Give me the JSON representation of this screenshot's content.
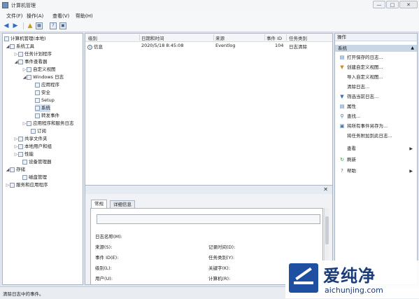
{
  "window": {
    "title": "计算机管理",
    "min": "—",
    "max": "□",
    "close": "✕"
  },
  "menu": [
    "文件(F)",
    "操作(A)",
    "查看(V)",
    "帮助(H)"
  ],
  "toolbar": {
    "back": "◀",
    "forward": "▶",
    "up": "▲",
    "b1": "▦",
    "b2": "?",
    "b3": "▣"
  },
  "tree": [
    {
      "label": "计算机管理(本地)",
      "indent": 0,
      "arrow": ""
    },
    {
      "label": "系统工具",
      "indent": 1,
      "arrow": "◢"
    },
    {
      "label": "任务计划程序",
      "indent": 2,
      "arrow": "▷"
    },
    {
      "label": "事件查看器",
      "indent": 2,
      "arrow": "◢"
    },
    {
      "label": "自定义视图",
      "indent": 3,
      "arrow": "▷"
    },
    {
      "label": "Windows 日志",
      "indent": 3,
      "arrow": "◢"
    },
    {
      "label": "应用程序",
      "indent": 4,
      "arrow": ""
    },
    {
      "label": "安全",
      "indent": 4,
      "arrow": ""
    },
    {
      "label": "Setup",
      "indent": 4,
      "arrow": ""
    },
    {
      "label": "系统",
      "indent": 4,
      "arrow": ""
    },
    {
      "label": "转发事件",
      "indent": 4,
      "arrow": ""
    },
    {
      "label": "应用程序和服务日志",
      "indent": 3,
      "arrow": "▷"
    },
    {
      "label": "订阅",
      "indent": 3,
      "arrow": ""
    },
    {
      "label": "共享文件夹",
      "indent": 2,
      "arrow": "▷"
    },
    {
      "label": "本地用户和组",
      "indent": 2,
      "arrow": "▷"
    },
    {
      "label": "性能",
      "indent": 2,
      "arrow": "▷"
    },
    {
      "label": "设备管理器",
      "indent": 2,
      "arrow": ""
    },
    {
      "label": "存储",
      "indent": 1,
      "arrow": "◢"
    },
    {
      "label": "磁盘管理",
      "indent": 2,
      "arrow": ""
    },
    {
      "label": "服务和应用程序",
      "indent": 1,
      "arrow": "▷"
    }
  ],
  "grid": {
    "headers": [
      "级别",
      "日期和时间",
      "来源",
      "事件 ID",
      "任务类别"
    ],
    "rows": [
      {
        "level": "信息",
        "datetime": "2020/5/18 8:45:08",
        "source": "Eventlog",
        "id": "104",
        "category": "日志清除"
      }
    ]
  },
  "detail": {
    "close": "✕",
    "tabs": [
      "常规",
      "详细信息"
    ],
    "fields_left": [
      "日志名称(M):",
      "来源(S):",
      "事件 ID(E):",
      "级别(L):",
      "用户(U):"
    ],
    "fields_right": [
      "记录时间(D):",
      "任务类别(Y):",
      "关键字(K):",
      "计算机(R):"
    ]
  },
  "actions": {
    "header": "操作",
    "section": "系统",
    "section_arrow": "▲",
    "items": [
      {
        "label": "打开保存的日志...",
        "icon": "▤",
        "sub": ""
      },
      {
        "label": "创建自定义视图...",
        "icon": "▼",
        "sub": ""
      },
      {
        "label": "导入自定义视图...",
        "icon": "",
        "sub": ""
      },
      {
        "label": "清除日志...",
        "icon": "",
        "sub": ""
      },
      {
        "label": "筛选当前日志...",
        "icon": "▼",
        "sub": ""
      },
      {
        "label": "属性",
        "icon": "▤",
        "sub": ""
      },
      {
        "label": "查找...",
        "icon": "⚲",
        "sub": ""
      },
      {
        "label": "将所有事件另存为...",
        "icon": "▣",
        "sub": ""
      },
      {
        "label": "将任务附加到此日志...",
        "icon": "",
        "sub": ""
      },
      {
        "label": "查看",
        "icon": "",
        "sub": "▶"
      },
      {
        "label": "刷新",
        "icon": "↻",
        "sub": ""
      },
      {
        "label": "帮助",
        "icon": "?",
        "sub": "▶"
      }
    ]
  },
  "status": "清除日志中的事件。",
  "watermark": {
    "brand": "爱纯净",
    "url": "aichunjing.com"
  }
}
